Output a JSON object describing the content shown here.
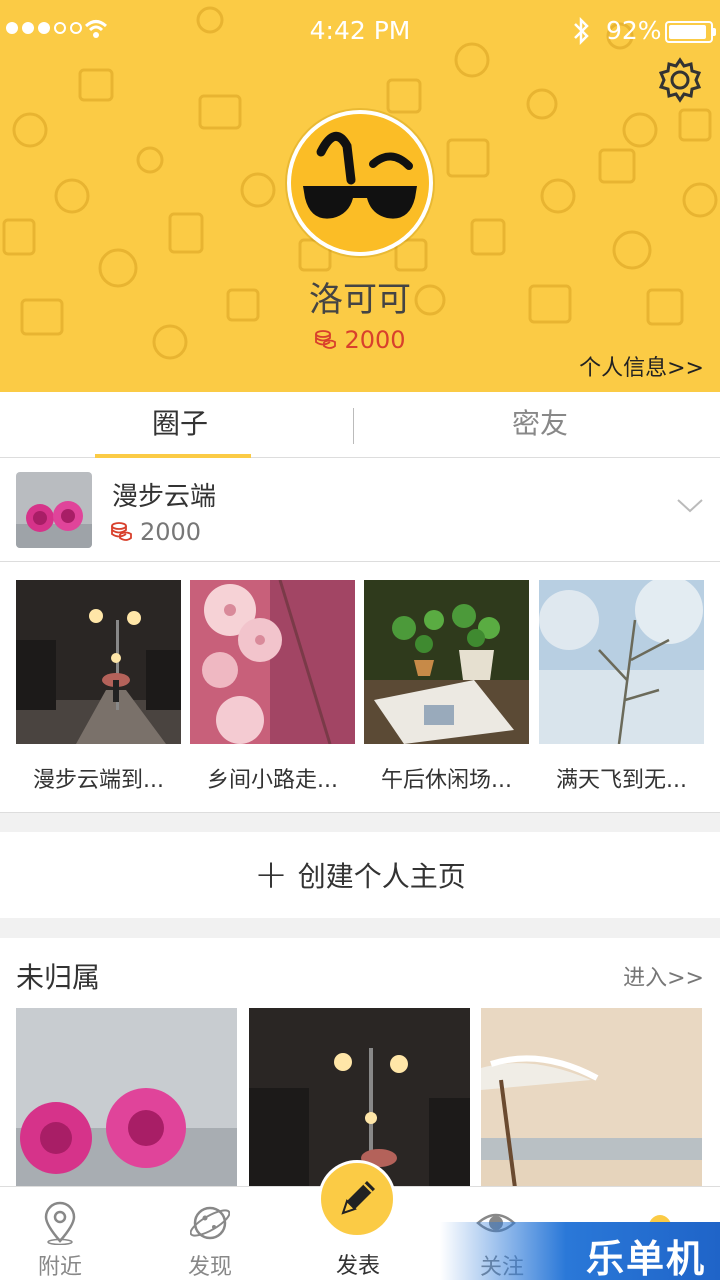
{
  "status": {
    "time": "4:42 PM",
    "battery": "92%",
    "battery_level": 0.92
  },
  "profile": {
    "name": "洛可可",
    "coins": "2000",
    "info_link": "个人信息>>"
  },
  "tabs": [
    {
      "label": "圈子",
      "active": true
    },
    {
      "label": "密友",
      "active": false
    }
  ],
  "circle": {
    "name": "漫步云端",
    "coins": "2000",
    "photos": [
      {
        "caption": "漫步云端到..."
      },
      {
        "caption": "乡间小路走..."
      },
      {
        "caption": "午后休闲场..."
      },
      {
        "caption": "满天飞到无..."
      }
    ]
  },
  "create": {
    "label": "创建个人主页"
  },
  "unassigned": {
    "title": "未归属",
    "enter": "进入>>"
  },
  "nav": [
    {
      "label": "附近",
      "icon": "location-pin-icon"
    },
    {
      "label": "发现",
      "icon": "planet-icon"
    },
    {
      "label": "发表",
      "icon": "pencil-icon"
    },
    {
      "label": "关注",
      "icon": "eye-icon"
    }
  ],
  "watermark": "乐单机",
  "colors": {
    "accent": "#fbcb45",
    "coin": "#d8402c"
  }
}
